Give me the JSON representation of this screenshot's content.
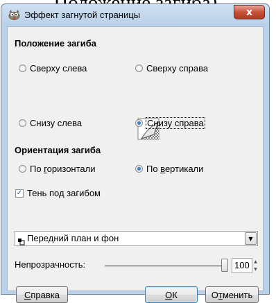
{
  "caption": "Положение загиба).",
  "window": {
    "title": "Эффект загнутой страницы",
    "close_glyph": "x",
    "icon": "gimp-icon"
  },
  "curl_location": {
    "title": "Положение загиба",
    "options": [
      {
        "label": "Сверху слева",
        "selected": false
      },
      {
        "label": "Сверху справа",
        "selected": false
      },
      {
        "label": "Снизу слева",
        "selected": false
      },
      {
        "label": "Снизу справа",
        "selected": true
      }
    ],
    "preview_icon": "page-curl-preview-icon"
  },
  "curl_orientation": {
    "title": "Ориентация загиба",
    "horizontal": {
      "pre": "По ",
      "mnemonic": "г",
      "post": "оризонтали",
      "selected": false
    },
    "vertical": {
      "pre": "По ",
      "mnemonic": "в",
      "post": "ертикали",
      "selected": true
    }
  },
  "shadow": {
    "label": "Тень под загибом",
    "checked": true,
    "check_glyph": "✓"
  },
  "gradient_combo": {
    "value": "Передний план и фон",
    "arrow_glyph": "▼"
  },
  "opacity": {
    "label": "Непрозрачность:",
    "value": "100",
    "up_glyph": "▲",
    "down_glyph": "▼"
  },
  "buttons": {
    "help": {
      "mnemonic": "С",
      "rest": "правка"
    },
    "ok": {
      "mnemonic": "О",
      "rest": "К"
    },
    "cancel": {
      "pre": "О",
      "mnemonic": "т",
      "rest": "менить"
    }
  }
}
